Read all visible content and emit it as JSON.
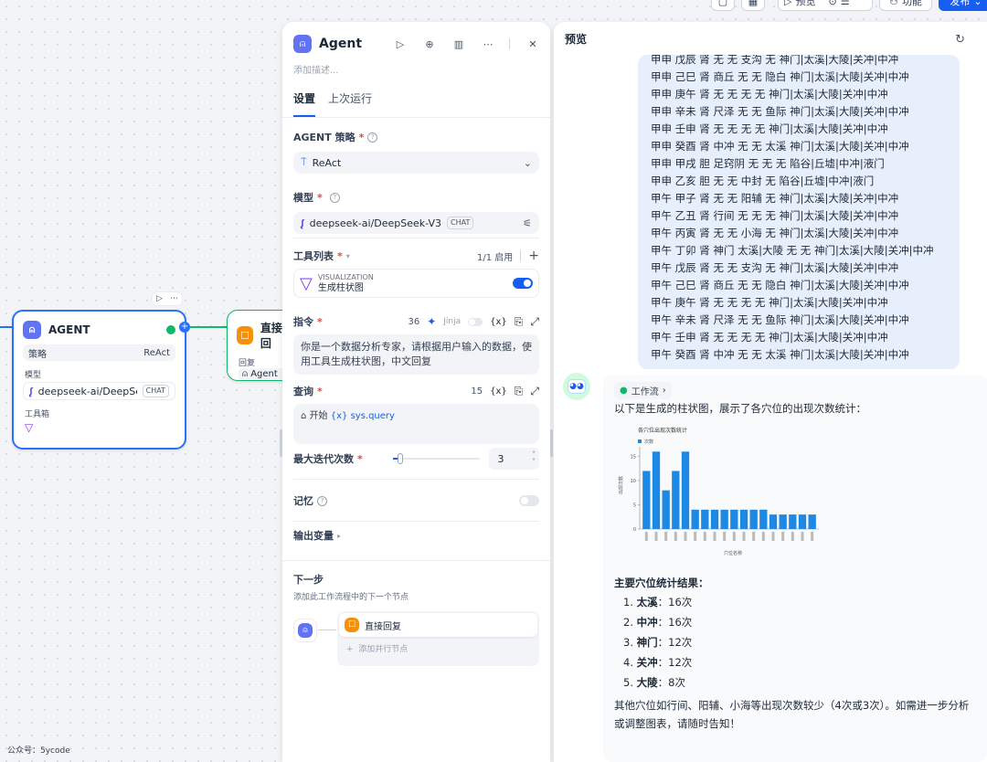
{
  "toolbar": {
    "preview_label": "预览",
    "features_label": "功能",
    "publish_label": "发布"
  },
  "canvas": {
    "agent_node": {
      "title": "AGENT",
      "strategy_key": "策略",
      "strategy_value": "ReAct",
      "model_label": "模型",
      "model_name": "deepseek-ai/DeepSe...",
      "model_chip": "CHAT",
      "toolbox_label": "工具箱"
    },
    "reply_node": {
      "title": "直接回",
      "reply_label": "回复",
      "reply_value": "Agent"
    },
    "watermark": "公众号：5ycode"
  },
  "panel": {
    "title": "Agent",
    "description_placeholder": "添加描述...",
    "tabs": [
      "设置",
      "上次运行"
    ],
    "strategy": {
      "label": "AGENT 策略",
      "value": "ReAct"
    },
    "model": {
      "label": "模型",
      "value": "deepseek-ai/DeepSeek-V3",
      "chip": "CHAT"
    },
    "tools": {
      "label": "工具列表",
      "count": "1/1 启用",
      "item_provider": "VISUALIZATION",
      "item_name": "生成柱状图"
    },
    "instruction": {
      "label": "指令",
      "count": "36",
      "jinja": "Jinja",
      "text": "你是一个数据分析专家，请根据用户输入的数据，使用工具生成柱状图，中文回复"
    },
    "query": {
      "label": "查询",
      "count": "15",
      "start": "开始",
      "var": "sys.query"
    },
    "iterations": {
      "label": "最大迭代次数",
      "value": "3"
    },
    "memory": {
      "label": "记忆"
    },
    "output": {
      "label": "输出变量"
    },
    "next_step": {
      "label": "下一步",
      "desc": "添加此工作流程中的下一个节点",
      "node": "直接回复",
      "add_parallel": "添加并行节点"
    }
  },
  "preview": {
    "title": "预览",
    "user_lines": [
      "甲申 戊辰 肾 无 无 支沟 无 神门|太溪|大陵|关冲|中冲",
      "甲申 己巳 肾 商丘 无 无 隐白 神门|太溪|大陵|关冲|中冲",
      "甲申 庚午 肾 无 无 无 无 神门|太溪|大陵|关冲|中冲",
      "甲申 辛未 肾 尺泽 无 无 鱼际 神门|太溪|大陵|关冲|中冲",
      "甲申 壬申 肾 无 无 无 无 神门|太溪|大陵|关冲|中冲",
      "甲申 癸酉 肾 中冲 无 无 太溪 神门|太溪|大陵|关冲|中冲",
      "甲申 甲戌 胆 足窍阴 无 无 无 陷谷|丘墟|中冲|液门",
      "甲申 乙亥 胆 无 无 中封 无 陷谷|丘墟|中冲|液门",
      "甲午 甲子 肾 无 无 阳辅 无 神门|太溪|大陵|关冲|中冲",
      "甲午 乙丑 肾 行间 无 无 无 神门|太溪|大陵|关冲|中冲",
      "甲午 丙寅 肾 无 无 小海 无 神门|太溪|大陵|关冲|中冲",
      "甲午 丁卯 肾 神门 太溪|大陵 无 无 神门|太溪|大陵|关冲|中冲",
      "甲午 戊辰 肾 无 无 支沟 无 神门|太溪|大陵|关冲|中冲",
      "甲午 己巳 肾 商丘 无 无 隐白 神门|太溪|大陵|关冲|中冲",
      "甲午 庚午 肾 无 无 无 无 神门|太溪|大陵|关冲|中冲",
      "甲午 辛未 肾 尺泽 无 无 鱼际 神门|太溪|大陵|关冲|中冲",
      "甲午 壬申 肾 无 无 无 无 神门|太溪|大陵|关冲|中冲",
      "甲午 癸酉 肾 中冲 无 无 太溪 神门|太溪|大陵|关冲|中冲"
    ],
    "workflow_chip": "工作流",
    "intro": "以下是生成的柱状图，展示了各穴位的出现次数统计：",
    "summary_title": "主要穴位统计结果：",
    "results": [
      {
        "num": "1.",
        "name": "太溪",
        "count": "：16次"
      },
      {
        "num": "2.",
        "name": "中冲",
        "count": "：16次"
      },
      {
        "num": "3.",
        "name": "神门",
        "count": "：12次"
      },
      {
        "num": "4.",
        "name": "关冲",
        "count": "：12次"
      },
      {
        "num": "5.",
        "name": "大陵",
        "count": "：8次"
      }
    ],
    "closing": "其他穴位如行间、阳辅、小海等出现次数较少（4次或3次）。如需进一步分析或调整图表，请随时告知！"
  },
  "chart_data": {
    "type": "bar",
    "title": "各穴位出现次数统计",
    "legend": [
      "次数"
    ],
    "xlabel": "穴位名称",
    "ylabel": "出现次数",
    "ylim": [
      0,
      17
    ],
    "yticks": [
      0,
      5,
      10,
      15
    ],
    "values": [
      12,
      16,
      8,
      12,
      16,
      4,
      4,
      4,
      4,
      4,
      4,
      4,
      4,
      3,
      3,
      3,
      3,
      3
    ],
    "color": "#1e88e5"
  }
}
